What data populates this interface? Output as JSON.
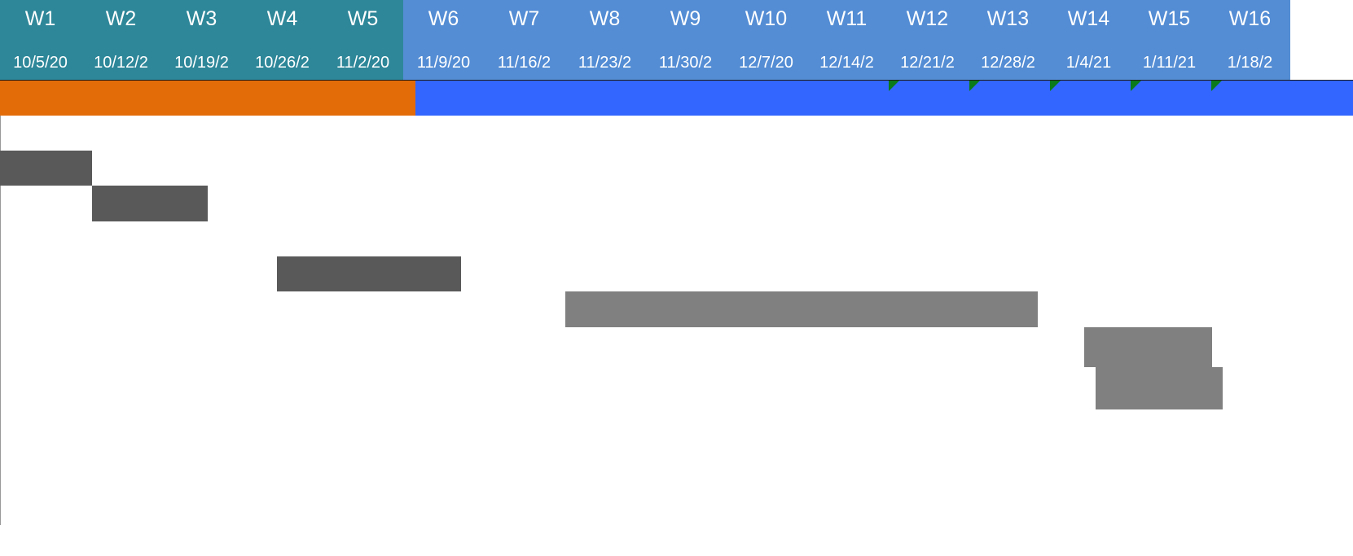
{
  "weeks": [
    {
      "label": "W1",
      "date": "10/5/20"
    },
    {
      "label": "W2",
      "date": "10/12/2"
    },
    {
      "label": "W3",
      "date": "10/19/2"
    },
    {
      "label": "W4",
      "date": "10/26/2"
    },
    {
      "label": "W5",
      "date": "11/2/20"
    },
    {
      "label": "W6",
      "date": "11/9/20"
    },
    {
      "label": "W7",
      "date": "11/16/2"
    },
    {
      "label": "W8",
      "date": "11/23/2"
    },
    {
      "label": "W9",
      "date": "11/30/2"
    },
    {
      "label": "W10",
      "date": "12/7/20"
    },
    {
      "label": "W11",
      "date": "12/14/2"
    },
    {
      "label": "W12",
      "date": "12/21/2"
    },
    {
      "label": "W13",
      "date": "12/28/2"
    },
    {
      "label": "W14",
      "date": "1/4/21"
    },
    {
      "label": "W15",
      "date": "1/11/21"
    },
    {
      "label": "W16",
      "date": "1/18/2"
    }
  ],
  "colors": {
    "header_group1": "#2e8799",
    "header_group2": "#548dd4",
    "phase1": "#e36c09",
    "phase2": "#3366ff",
    "marker": "#0a7a1a",
    "task_dark": "#595959",
    "task_light": "#808080"
  }
}
